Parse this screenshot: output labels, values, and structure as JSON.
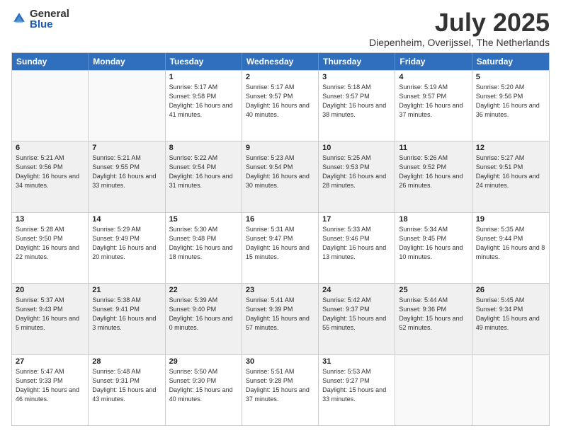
{
  "logo": {
    "general": "General",
    "blue": "Blue"
  },
  "title": "July 2025",
  "location": "Diepenheim, Overijssel, The Netherlands",
  "days_of_week": [
    "Sunday",
    "Monday",
    "Tuesday",
    "Wednesday",
    "Thursday",
    "Friday",
    "Saturday"
  ],
  "weeks": [
    [
      {
        "day": "",
        "sunrise": "",
        "sunset": "",
        "daylight": ""
      },
      {
        "day": "",
        "sunrise": "",
        "sunset": "",
        "daylight": ""
      },
      {
        "day": "1",
        "sunrise": "Sunrise: 5:17 AM",
        "sunset": "Sunset: 9:58 PM",
        "daylight": "Daylight: 16 hours and 41 minutes."
      },
      {
        "day": "2",
        "sunrise": "Sunrise: 5:17 AM",
        "sunset": "Sunset: 9:57 PM",
        "daylight": "Daylight: 16 hours and 40 minutes."
      },
      {
        "day": "3",
        "sunrise": "Sunrise: 5:18 AM",
        "sunset": "Sunset: 9:57 PM",
        "daylight": "Daylight: 16 hours and 38 minutes."
      },
      {
        "day": "4",
        "sunrise": "Sunrise: 5:19 AM",
        "sunset": "Sunset: 9:57 PM",
        "daylight": "Daylight: 16 hours and 37 minutes."
      },
      {
        "day": "5",
        "sunrise": "Sunrise: 5:20 AM",
        "sunset": "Sunset: 9:56 PM",
        "daylight": "Daylight: 16 hours and 36 minutes."
      }
    ],
    [
      {
        "day": "6",
        "sunrise": "Sunrise: 5:21 AM",
        "sunset": "Sunset: 9:56 PM",
        "daylight": "Daylight: 16 hours and 34 minutes."
      },
      {
        "day": "7",
        "sunrise": "Sunrise: 5:21 AM",
        "sunset": "Sunset: 9:55 PM",
        "daylight": "Daylight: 16 hours and 33 minutes."
      },
      {
        "day": "8",
        "sunrise": "Sunrise: 5:22 AM",
        "sunset": "Sunset: 9:54 PM",
        "daylight": "Daylight: 16 hours and 31 minutes."
      },
      {
        "day": "9",
        "sunrise": "Sunrise: 5:23 AM",
        "sunset": "Sunset: 9:54 PM",
        "daylight": "Daylight: 16 hours and 30 minutes."
      },
      {
        "day": "10",
        "sunrise": "Sunrise: 5:25 AM",
        "sunset": "Sunset: 9:53 PM",
        "daylight": "Daylight: 16 hours and 28 minutes."
      },
      {
        "day": "11",
        "sunrise": "Sunrise: 5:26 AM",
        "sunset": "Sunset: 9:52 PM",
        "daylight": "Daylight: 16 hours and 26 minutes."
      },
      {
        "day": "12",
        "sunrise": "Sunrise: 5:27 AM",
        "sunset": "Sunset: 9:51 PM",
        "daylight": "Daylight: 16 hours and 24 minutes."
      }
    ],
    [
      {
        "day": "13",
        "sunrise": "Sunrise: 5:28 AM",
        "sunset": "Sunset: 9:50 PM",
        "daylight": "Daylight: 16 hours and 22 minutes."
      },
      {
        "day": "14",
        "sunrise": "Sunrise: 5:29 AM",
        "sunset": "Sunset: 9:49 PM",
        "daylight": "Daylight: 16 hours and 20 minutes."
      },
      {
        "day": "15",
        "sunrise": "Sunrise: 5:30 AM",
        "sunset": "Sunset: 9:48 PM",
        "daylight": "Daylight: 16 hours and 18 minutes."
      },
      {
        "day": "16",
        "sunrise": "Sunrise: 5:31 AM",
        "sunset": "Sunset: 9:47 PM",
        "daylight": "Daylight: 16 hours and 15 minutes."
      },
      {
        "day": "17",
        "sunrise": "Sunrise: 5:33 AM",
        "sunset": "Sunset: 9:46 PM",
        "daylight": "Daylight: 16 hours and 13 minutes."
      },
      {
        "day": "18",
        "sunrise": "Sunrise: 5:34 AM",
        "sunset": "Sunset: 9:45 PM",
        "daylight": "Daylight: 16 hours and 10 minutes."
      },
      {
        "day": "19",
        "sunrise": "Sunrise: 5:35 AM",
        "sunset": "Sunset: 9:44 PM",
        "daylight": "Daylight: 16 hours and 8 minutes."
      }
    ],
    [
      {
        "day": "20",
        "sunrise": "Sunrise: 5:37 AM",
        "sunset": "Sunset: 9:43 PM",
        "daylight": "Daylight: 16 hours and 5 minutes."
      },
      {
        "day": "21",
        "sunrise": "Sunrise: 5:38 AM",
        "sunset": "Sunset: 9:41 PM",
        "daylight": "Daylight: 16 hours and 3 minutes."
      },
      {
        "day": "22",
        "sunrise": "Sunrise: 5:39 AM",
        "sunset": "Sunset: 9:40 PM",
        "daylight": "Daylight: 16 hours and 0 minutes."
      },
      {
        "day": "23",
        "sunrise": "Sunrise: 5:41 AM",
        "sunset": "Sunset: 9:39 PM",
        "daylight": "Daylight: 15 hours and 57 minutes."
      },
      {
        "day": "24",
        "sunrise": "Sunrise: 5:42 AM",
        "sunset": "Sunset: 9:37 PM",
        "daylight": "Daylight: 15 hours and 55 minutes."
      },
      {
        "day": "25",
        "sunrise": "Sunrise: 5:44 AM",
        "sunset": "Sunset: 9:36 PM",
        "daylight": "Daylight: 15 hours and 52 minutes."
      },
      {
        "day": "26",
        "sunrise": "Sunrise: 5:45 AM",
        "sunset": "Sunset: 9:34 PM",
        "daylight": "Daylight: 15 hours and 49 minutes."
      }
    ],
    [
      {
        "day": "27",
        "sunrise": "Sunrise: 5:47 AM",
        "sunset": "Sunset: 9:33 PM",
        "daylight": "Daylight: 15 hours and 46 minutes."
      },
      {
        "day": "28",
        "sunrise": "Sunrise: 5:48 AM",
        "sunset": "Sunset: 9:31 PM",
        "daylight": "Daylight: 15 hours and 43 minutes."
      },
      {
        "day": "29",
        "sunrise": "Sunrise: 5:50 AM",
        "sunset": "Sunset: 9:30 PM",
        "daylight": "Daylight: 15 hours and 40 minutes."
      },
      {
        "day": "30",
        "sunrise": "Sunrise: 5:51 AM",
        "sunset": "Sunset: 9:28 PM",
        "daylight": "Daylight: 15 hours and 37 minutes."
      },
      {
        "day": "31",
        "sunrise": "Sunrise: 5:53 AM",
        "sunset": "Sunset: 9:27 PM",
        "daylight": "Daylight: 15 hours and 33 minutes."
      },
      {
        "day": "",
        "sunrise": "",
        "sunset": "",
        "daylight": ""
      },
      {
        "day": "",
        "sunrise": "",
        "sunset": "",
        "daylight": ""
      }
    ]
  ]
}
